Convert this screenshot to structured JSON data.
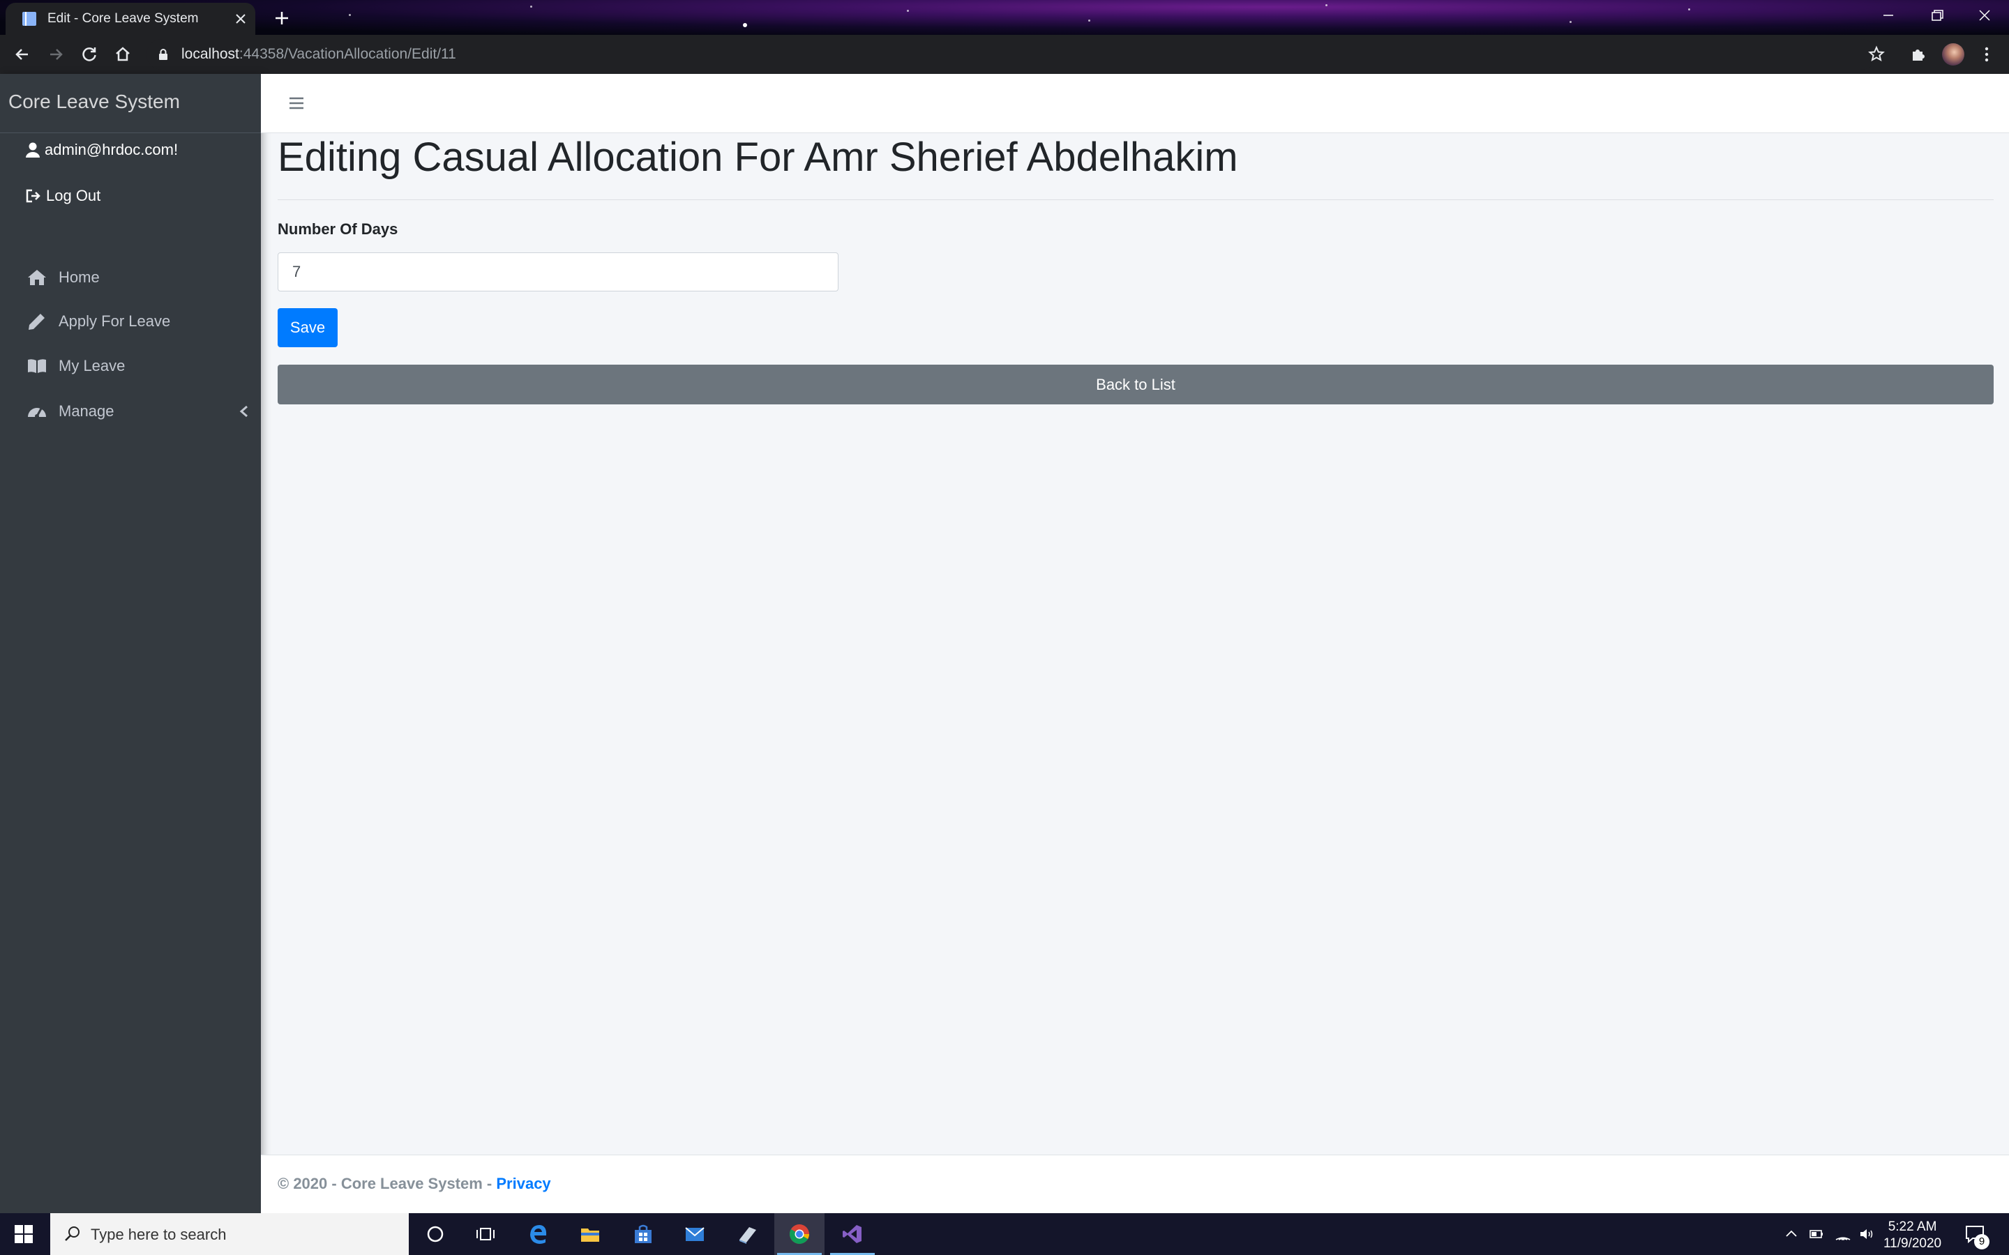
{
  "browser": {
    "tab_title": "Edit - Core Leave System",
    "url_host": "localhost",
    "url_path": ":44358/VacationAllocation/Edit/11"
  },
  "sidebar": {
    "brand": "Core Leave System",
    "user_email": "admin@hrdoc.com!",
    "logout_label": "Log Out",
    "items": [
      {
        "label": "Home",
        "icon": "home-icon"
      },
      {
        "label": "Apply For Leave",
        "icon": "pencil-icon"
      },
      {
        "label": "My Leave",
        "icon": "book-icon"
      },
      {
        "label": "Manage",
        "icon": "dashboard-icon"
      }
    ]
  },
  "main": {
    "title": "Editing Casual Allocation For Amr Sherief Abdelhakim",
    "field_label": "Number Of Days",
    "number_of_days": "7",
    "save_label": "Save",
    "back_label": "Back to List"
  },
  "footer": {
    "copyright": "© 2020 - Core Leave System - ",
    "privacy_label": "Privacy"
  },
  "taskbar": {
    "search_placeholder": "Type here to search",
    "time": "5:22 AM",
    "date": "11/9/2020",
    "notification_count": "9"
  },
  "colors": {
    "sidebar_bg": "#343a40",
    "primary": "#007bff",
    "secondary": "#6c757d",
    "content_bg": "#f4f6f9"
  }
}
